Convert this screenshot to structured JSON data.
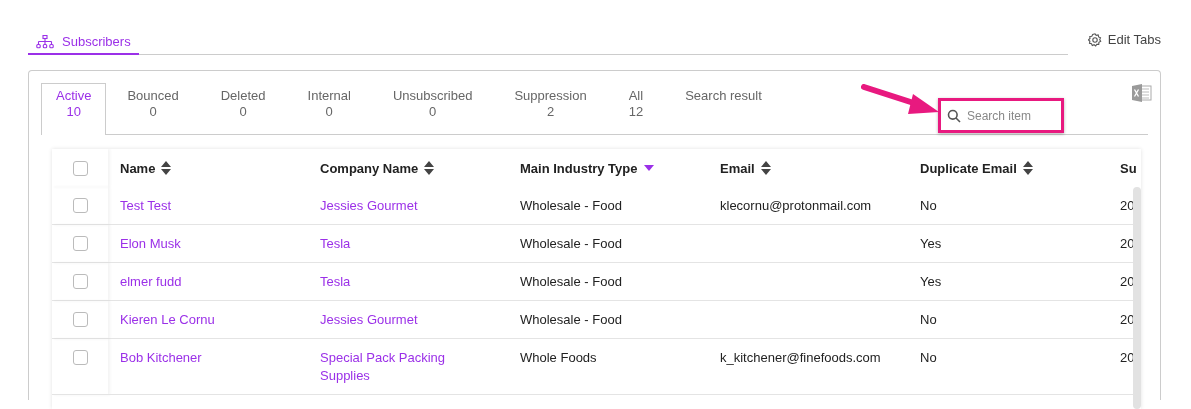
{
  "page_tabs": [
    {
      "label": "Subscribers",
      "selected": true
    }
  ],
  "edit_tabs": "Edit Tabs",
  "status_tabs": [
    {
      "label": "Active",
      "count": "10",
      "selected": true
    },
    {
      "label": "Bounced",
      "count": "0",
      "selected": false
    },
    {
      "label": "Deleted",
      "count": "0",
      "selected": false
    },
    {
      "label": "Internal",
      "count": "0",
      "selected": false
    },
    {
      "label": "Unsubscribed",
      "count": "0",
      "selected": false
    },
    {
      "label": "Suppression",
      "count": "2",
      "selected": false
    },
    {
      "label": "All",
      "count": "12",
      "selected": false
    },
    {
      "label": "Search result",
      "selected": false
    }
  ],
  "search": {
    "placeholder": "Search item",
    "highlighted": true
  },
  "table": {
    "select_all_checked": false,
    "columns": [
      {
        "label": "Name",
        "sortable": true,
        "sorted": false
      },
      {
        "label": "Company Name",
        "sortable": true,
        "sorted": false
      },
      {
        "label": "Main Industry Type",
        "sortable": true,
        "sorted": true
      },
      {
        "label": "Email",
        "sortable": true,
        "sorted": false
      },
      {
        "label": "Duplicate Email",
        "sortable": true,
        "sorted": false
      },
      {
        "label": "Su"
      }
    ],
    "rows": [
      {
        "checked": false,
        "cells": [
          "Test Test",
          "Jessies Gourmet",
          "Wholesale - Food",
          "klecornu@protonmail.com",
          "No",
          "20"
        ]
      },
      {
        "checked": false,
        "cells": [
          "Elon Musk",
          "Tesla",
          "Wholesale - Food",
          "",
          "Yes",
          "20"
        ]
      },
      {
        "checked": false,
        "cells": [
          "elmer fudd",
          "Tesla",
          "Wholesale - Food",
          "",
          "Yes",
          "20"
        ]
      },
      {
        "checked": false,
        "cells": [
          "Kieren Le Cornu",
          "Jessies Gourmet",
          "Wholesale - Food",
          "",
          "No",
          "20"
        ]
      },
      {
        "checked": false,
        "cells": [
          "Bob Kitchener",
          "Special Pack Packing Supplies",
          "Whole Foods",
          "k_kitchener@finefoods.com",
          "No",
          "20"
        ]
      }
    ]
  },
  "callout": {
    "color": "#e8197f"
  }
}
